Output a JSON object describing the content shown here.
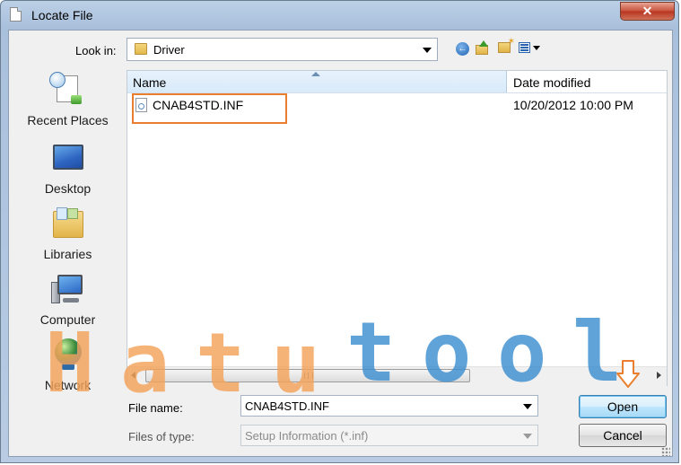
{
  "window": {
    "title": "Locate File",
    "close_label": "✕"
  },
  "toolbar": {
    "lookin_label": "Look in:",
    "lookin_value": "Driver",
    "back_icon": "back-arrow-icon",
    "up_icon": "up-folder-icon",
    "new_folder_icon": "new-folder-icon",
    "view_icon": "view-menu-icon"
  },
  "places": [
    {
      "label": "Recent Places",
      "icon": "recent-places-icon"
    },
    {
      "label": "Desktop",
      "icon": "desktop-icon"
    },
    {
      "label": "Libraries",
      "icon": "libraries-icon"
    },
    {
      "label": "Computer",
      "icon": "computer-icon"
    },
    {
      "label": "Network",
      "icon": "network-icon"
    }
  ],
  "filelist": {
    "columns": [
      "Name",
      "Date modified"
    ],
    "rows": [
      {
        "name": "CNAB4STD.INF",
        "date": "10/20/2012 10:00 PM"
      }
    ]
  },
  "form": {
    "filename_label": "File name:",
    "filename_value": "CNAB4STD.INF",
    "filetype_label": "Files of type:",
    "filetype_value": "Setup Information (*.inf)"
  },
  "buttons": {
    "open": "Open",
    "cancel": "Cancel"
  },
  "watermark": {
    "text": "Hatutool"
  },
  "colors": {
    "highlight": "#e97f2e",
    "watermark_orange": "#f4a35a",
    "watermark_blue": "#3d8fd0"
  }
}
